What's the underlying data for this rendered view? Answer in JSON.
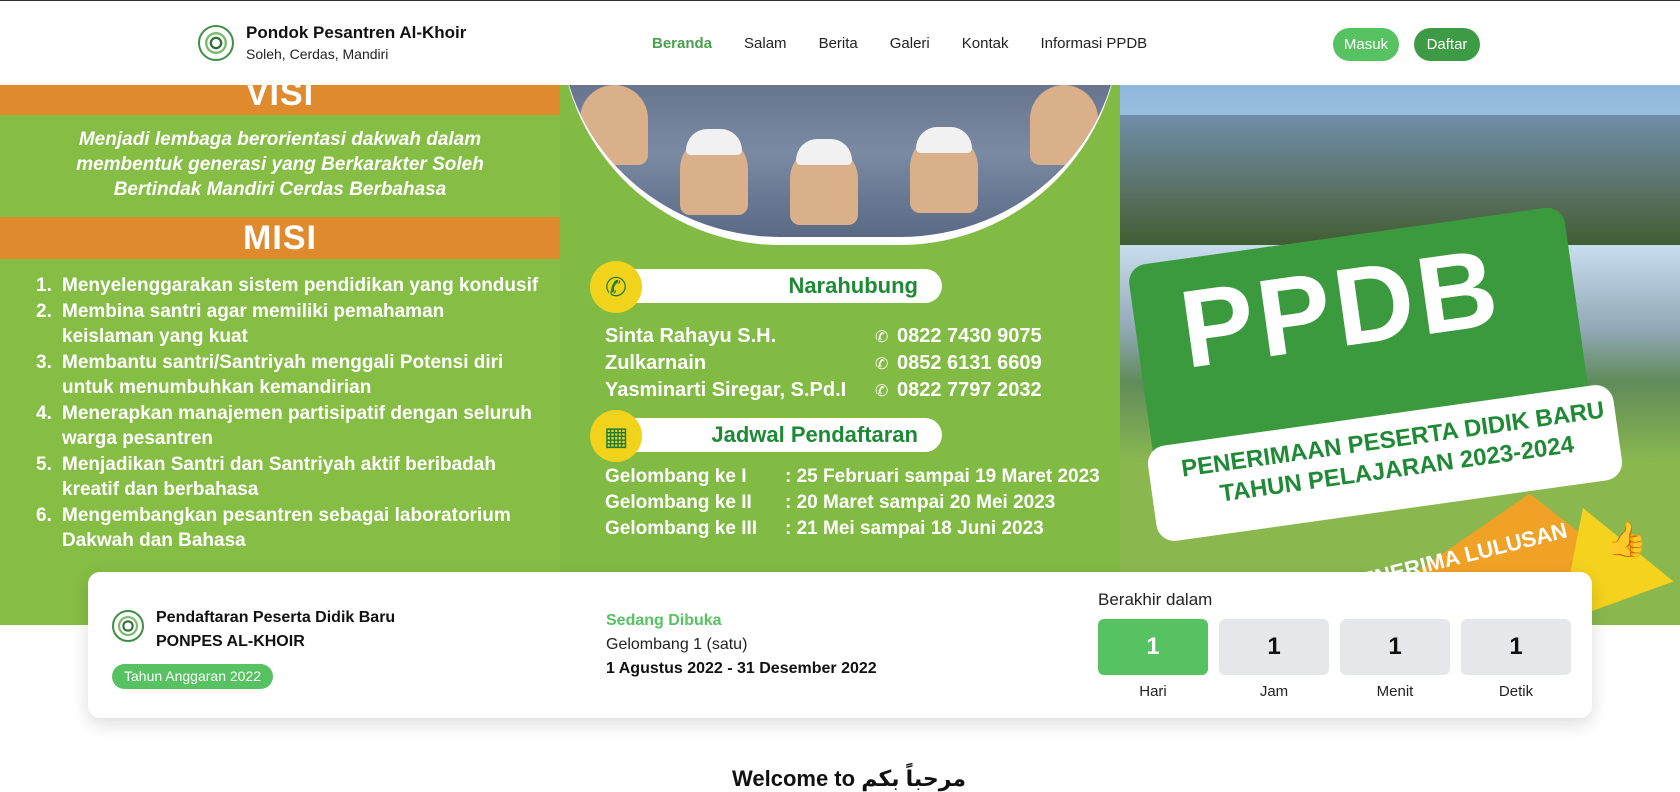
{
  "header": {
    "title": "Pondok Pesantren Al-Khoir",
    "tagline": "Soleh, Cerdas, Mandiri",
    "nav": [
      {
        "label": "Beranda"
      },
      {
        "label": "Salam"
      },
      {
        "label": "Berita"
      },
      {
        "label": "Galeri"
      },
      {
        "label": "Kontak"
      },
      {
        "label": "Informasi PPDB"
      }
    ],
    "login_label": "Masuk",
    "register_label": "Daftar",
    "accent": "#56c262"
  },
  "banner": {
    "visi_heading": "VISI",
    "visi_text": "Menjadi lembaga berorientasi dakwah dalam membentuk generasi yang Berkarakter Soleh Bertindak Mandiri Cerdas Berbahasa",
    "misi_heading": "MISI",
    "misi": [
      {
        "num": "1.",
        "text": "Menyelenggarakan sistem pendidikan yang kondusif"
      },
      {
        "num": "2.",
        "text": "Membina santri agar memiliki pemahaman keislaman yang kuat"
      },
      {
        "num": "3.",
        "text": "Membantu santri/Santriyah menggali Potensi diri untuk menumbuhkan kemandirian"
      },
      {
        "num": "4.",
        "text": "Menerapkan manajemen partisipatif dengan seluruh warga pesantren"
      },
      {
        "num": "5.",
        "text": "Menjadikan Santri dan Santriyah aktif beribadah kreatif dan berbahasa"
      },
      {
        "num": "6.",
        "text": "Mengembangkan pesantren sebagai laboratorium Dakwah dan Bahasa"
      }
    ],
    "contact_heading": "Narahubung",
    "contacts": [
      {
        "name": "Sinta Rahayu S.H.",
        "phone": "0822 7430 9075"
      },
      {
        "name": "Zulkarnain",
        "phone": "0852 6131 6609"
      },
      {
        "name": "Yasminarti Siregar, S.Pd.I",
        "phone": "0822 7797 2032"
      }
    ],
    "schedule_heading": "Jadwal Pendaftaran",
    "schedule": [
      {
        "label": "Gelombang ke I",
        "value": ": 25 Februari sampai 19 Maret 2023"
      },
      {
        "label": "Gelombang ke II",
        "value": ": 20 Maret sampai 20 Mei 2023"
      },
      {
        "label": "Gelombang ke III",
        "value": ": 21 Mei sampai 18 Juni 2023"
      }
    ],
    "ppdb_title": "PPDB",
    "ppdb_line1": "PENERIMAAN PESERTA DIDIK BARU",
    "ppdb_line2": "TAHUN PELAJARAN 2023-2024",
    "ppdb_accept": "MENERIMA LULUSAN"
  },
  "card": {
    "title_line1": "Pendaftaran Peserta Didik Baru",
    "title_line2": "PONPES AL-KHOIR",
    "badge": "Tahun Anggaran 2022",
    "status": "Sedang Dibuka",
    "wave": "Gelombang 1 (satu)",
    "date_range": "1 Agustus 2022 - 31 Desember 2022",
    "ends_label": "Berakhir dalam",
    "countdown": [
      {
        "value": "1",
        "label": "Hari"
      },
      {
        "value": "1",
        "label": "Jam"
      },
      {
        "value": "1",
        "label": "Menit"
      },
      {
        "value": "1",
        "label": "Detik"
      }
    ]
  },
  "welcome": "Welcome to مرحباً بكم"
}
